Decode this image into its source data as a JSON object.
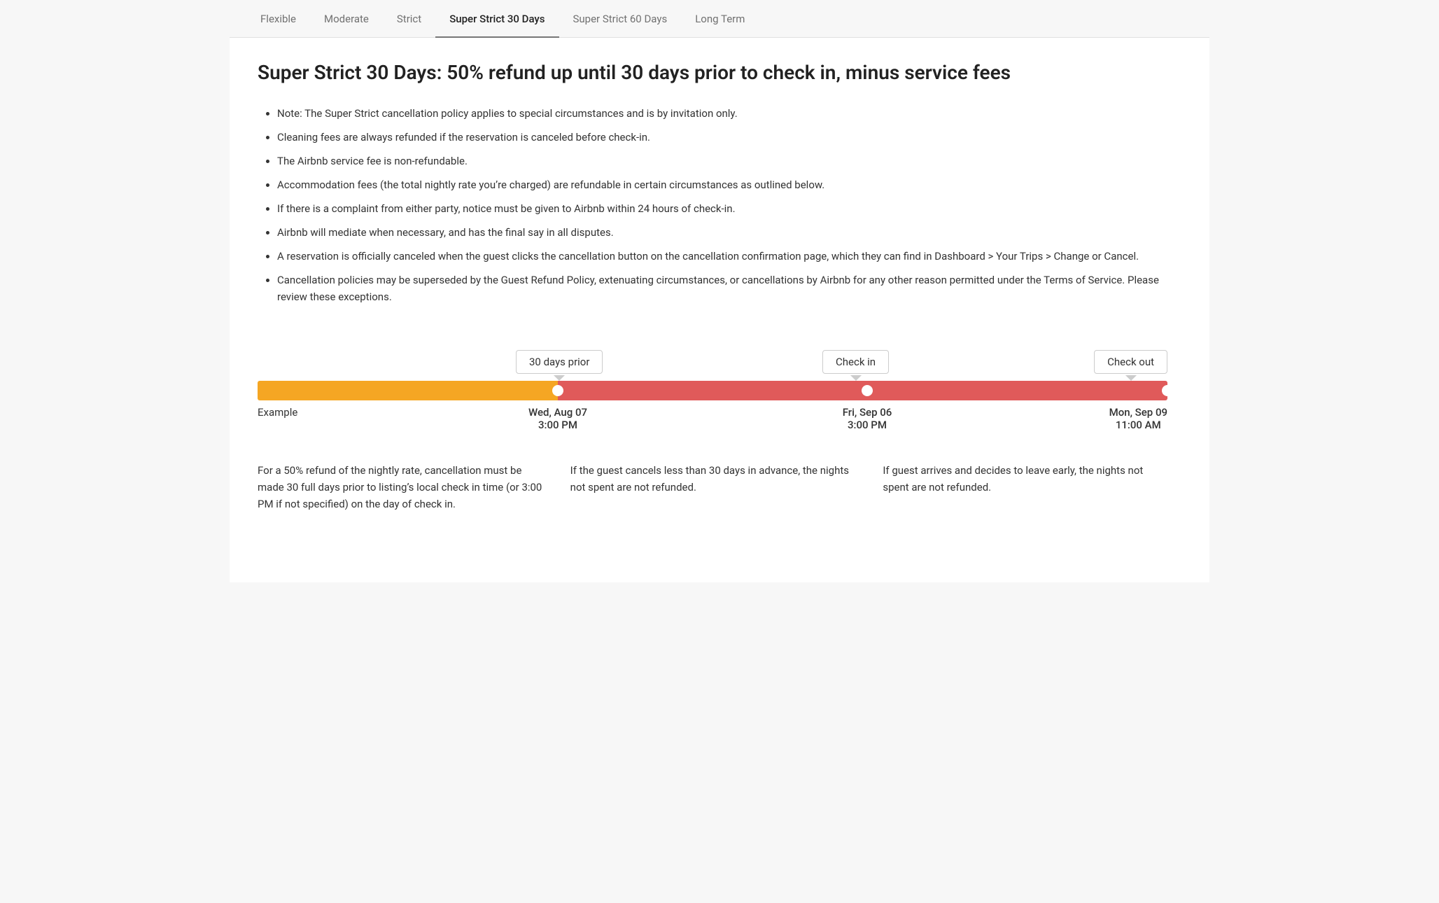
{
  "tabs": [
    {
      "id": "flexible",
      "label": "Flexible",
      "active": false
    },
    {
      "id": "moderate",
      "label": "Moderate",
      "active": false
    },
    {
      "id": "strict",
      "label": "Strict",
      "active": false
    },
    {
      "id": "super-strict-30",
      "label": "Super Strict 30 Days",
      "active": true
    },
    {
      "id": "super-strict-60",
      "label": "Super Strict 60 Days",
      "active": false
    },
    {
      "id": "long-term",
      "label": "Long Term",
      "active": false
    }
  ],
  "page_title": "Super Strict 30 Days: 50% refund up until 30 days prior to check in, minus service fees",
  "bullet_points": [
    "Note: The Super Strict cancellation policy applies to special circumstances and is by invitation only.",
    "Cleaning fees are always refunded if the reservation is canceled before check-in.",
    "The Airbnb service fee is non-refundable.",
    "Accommodation fees (the total nightly rate you’re charged) are refundable in certain circumstances as outlined below.",
    "If there is a complaint from either party, notice must be given to Airbnb within 24 hours of check-in.",
    "Airbnb will mediate when necessary, and has the final say in all disputes.",
    "A reservation is officially canceled when the guest clicks the cancellation button on the cancellation confirmation page, which they can find in Dashboard > Your Trips > Change or Cancel.",
    "Cancellation policies may be superseded by the Guest Refund Policy, extenuating circumstances, or cancellations by Airbnb for any other reason permitted under the Terms of Service. Please review these exceptions."
  ],
  "timeline": {
    "label_30_days": "30 days prior",
    "label_checkin": "Check in",
    "label_checkout": "Check out",
    "example_label": "Example",
    "date1_line1": "Wed, Aug 07",
    "date1_line2": "3:00 PM",
    "date2_line1": "Fri, Sep 06",
    "date2_line2": "3:00 PM",
    "date3_line1": "Mon, Sep 09",
    "date3_line2": "11:00 AM",
    "desc1": "For a 50% refund of the nightly rate, cancellation must be made 30 full days prior to listing’s local check in time (or 3:00 PM if not specified) on the day of check in.",
    "desc2": "If the guest cancels less than 30 days in advance, the nights not spent are not refunded.",
    "desc3": "If guest arrives and decides to leave early, the nights not spent are not refunded.",
    "colors": {
      "yellow": "#F5A623",
      "red": "#E05A5A",
      "dot": "#ffffff"
    }
  }
}
